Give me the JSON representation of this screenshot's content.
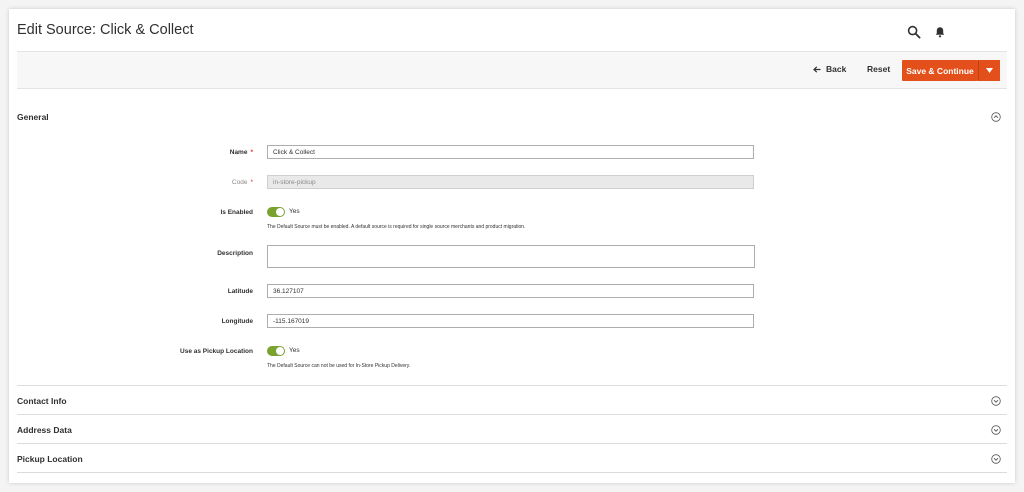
{
  "page": {
    "title": "Edit Source: Click & Collect"
  },
  "header": {
    "search_icon": "search-icon",
    "notifications_icon": "bell-icon"
  },
  "actions": {
    "back_label": "Back",
    "reset_label": "Reset",
    "save_label": "Save & Continue"
  },
  "sections": {
    "general": "General",
    "contact_info": "Contact Info",
    "address_data": "Address Data",
    "pickup_location": "Pickup Location"
  },
  "form": {
    "name": {
      "label": "Name",
      "value": "Click & Collect",
      "required": "*"
    },
    "code": {
      "label": "Code",
      "value": "in-store-pickup",
      "required": "*"
    },
    "is_enabled": {
      "label": "Is Enabled",
      "value": "Yes",
      "note": "The Default Source must be enabled. A default source is required for single source merchants and product migration."
    },
    "description": {
      "label": "Description",
      "value": ""
    },
    "latitude": {
      "label": "Latitude",
      "value": "36.127107"
    },
    "longitude": {
      "label": "Longitude",
      "value": "-115.167019"
    },
    "use_as_pickup": {
      "label": "Use as Pickup Location",
      "value": "Yes",
      "note": "The Default Source can not be used for In-Store Pickup Delivery."
    }
  },
  "colors": {
    "primary_button": "#e3501b",
    "toggle_on": "#79a22e",
    "required_mark": "#e02b27"
  }
}
